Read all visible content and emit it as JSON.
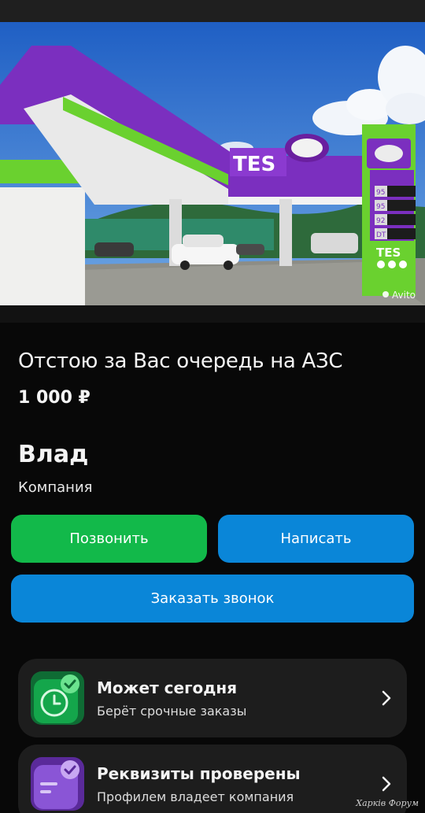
{
  "listing": {
    "title": "Отстою за Вас очередь на АЗС",
    "price": "1 000 ₽",
    "photo": {
      "station_brand": "TES",
      "watermark": "Avito",
      "price_board": [
        "95",
        "95",
        "92",
        "DT"
      ]
    }
  },
  "seller": {
    "name": "Влад",
    "type": "Компания"
  },
  "actions": {
    "call_label": "Позвонить",
    "message_label": "Написать",
    "order_call_label": "Заказать звонок"
  },
  "badges": [
    {
      "title": "Может сегодня",
      "subtitle": "Берёт срочные заказы",
      "icon": "clock-check-icon"
    },
    {
      "title": "Реквизиты проверены",
      "subtitle": "Профилем владеет компания",
      "icon": "document-check-icon"
    }
  ],
  "forum_watermark": "Харків Форум",
  "colors": {
    "call": "#12b94a",
    "message": "#0a86d8",
    "card_bg": "#1d1d1d",
    "brand_purple": "#7b2fbf",
    "brand_green": "#6ad12f"
  }
}
